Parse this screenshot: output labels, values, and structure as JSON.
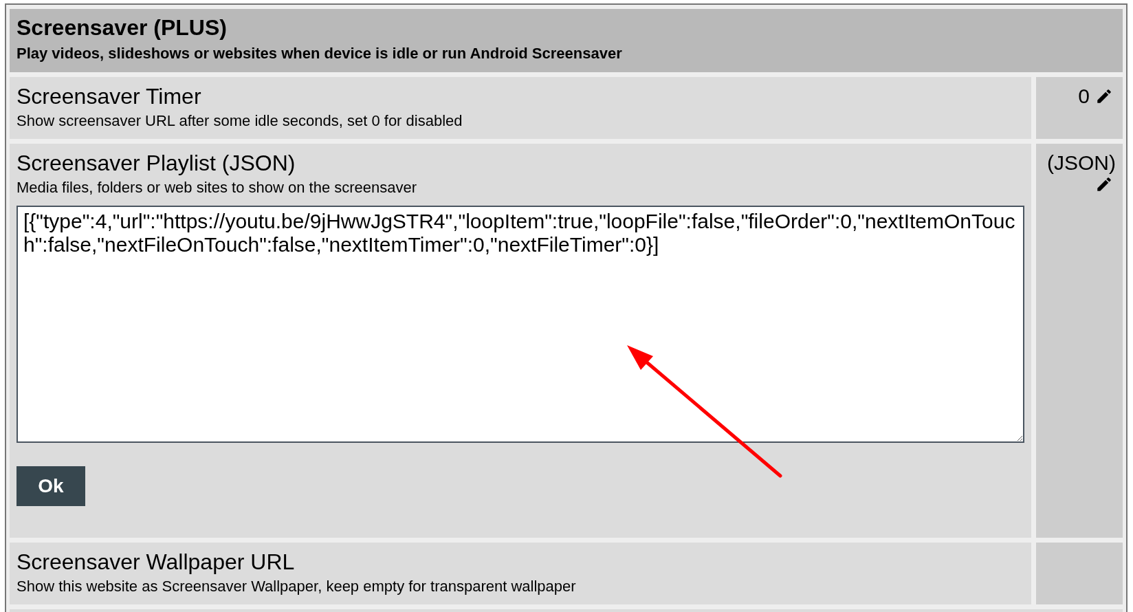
{
  "section": {
    "title": "Screensaver (PLUS)",
    "subtitle": "Play videos, slideshows or websites when device is idle or run Android Screensaver"
  },
  "settings": [
    {
      "kind": "value",
      "title": "Screensaver Timer",
      "description": "Show screensaver URL after some idle seconds, set 0 for disabled",
      "value": "0",
      "editable": true
    },
    {
      "kind": "editor",
      "title": "Screensaver Playlist (JSON)",
      "description": "Media files, folders or web sites to show on the screensaver",
      "value": "(JSON)",
      "editable": true,
      "editor_text": "[{\"type\":4,\"url\":\"https://youtu.be/9jHwwJgSTR4\",\"loopItem\":true,\"loopFile\":false,\"fileOrder\":0,\"nextItemOnTouch\":false,\"nextFileOnTouch\":false,\"nextItemTimer\":0,\"nextFileTimer\":0}]",
      "button": "Ok"
    },
    {
      "kind": "value",
      "title": "Screensaver Wallpaper URL",
      "description": "Show this website as Screensaver Wallpaper, keep empty for transparent wallpaper",
      "editable": false
    }
  ]
}
